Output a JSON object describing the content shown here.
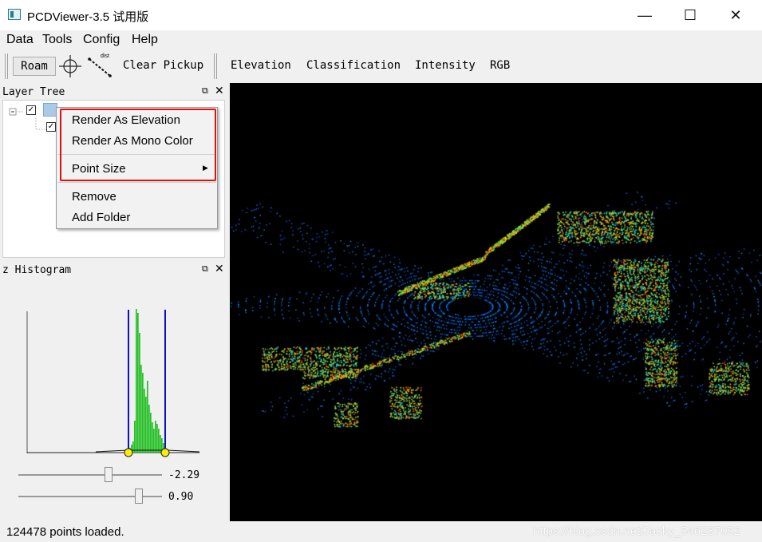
{
  "window": {
    "title": "PCDViewer-3.5 试用版"
  },
  "menubar": {
    "items": [
      "Data",
      "Tools",
      "Config",
      "Help"
    ]
  },
  "toolbar": {
    "roam": "Roam",
    "dist_label": "dist",
    "clear_pickup": "Clear Pickup",
    "elevation": "Elevation",
    "classification": "Classification",
    "intensity": "Intensity",
    "rgb": "RGB"
  },
  "layer_tree": {
    "title": "Layer Tree"
  },
  "context_menu": {
    "items": [
      "Render As Elevation",
      "Render As Mono Color",
      "Point Size",
      "Remove",
      "Add Folder"
    ]
  },
  "histogram": {
    "title": "z Histogram",
    "min_value": "-2.29",
    "max_value": "0.90",
    "min_slider_fraction": 0.63,
    "max_slider_fraction": 0.84
  },
  "status": {
    "text": "124478 points loaded."
  },
  "watermark": "https://blog.csdn.net/Jacky_546287052",
  "colors": {
    "highlight": "#e01010",
    "histogram_bar": "#22c022",
    "range_line": "#1010c8"
  },
  "icons": [
    "app-icon",
    "crosshair-icon",
    "distance-icon",
    "checkbox-icon",
    "submenu-arrow-icon",
    "float-icon",
    "close-icon"
  ]
}
